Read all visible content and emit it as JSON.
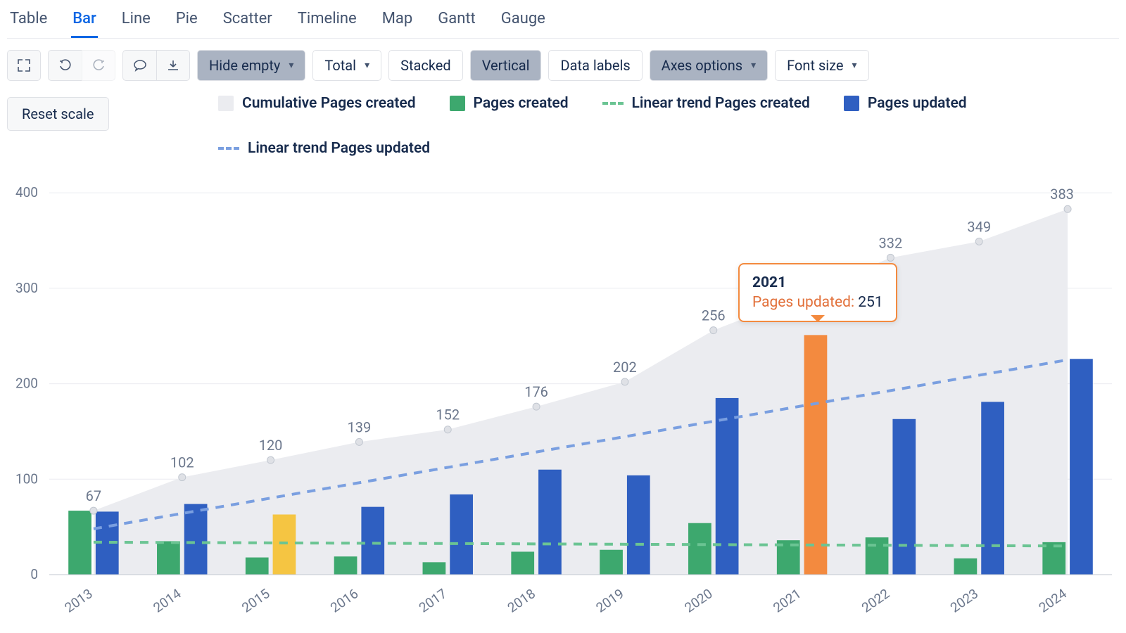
{
  "tabs": [
    "Table",
    "Bar",
    "Line",
    "Pie",
    "Scatter",
    "Timeline",
    "Map",
    "Gantt",
    "Gauge"
  ],
  "active_tab": "Bar",
  "toolbar": {
    "hide_empty": "Hide empty",
    "total": "Total",
    "stacked": "Stacked",
    "vertical": "Vertical",
    "data_labels": "Data labels",
    "axes_options": "Axes options",
    "font_size": "Font size",
    "reset_scale": "Reset scale"
  },
  "legend": {
    "cum": "Cumulative Pages created",
    "created": "Pages created",
    "trend_created": "Linear trend Pages created",
    "updated": "Pages updated",
    "trend_updated": "Linear trend Pages updated"
  },
  "colors": {
    "cum": "#EBECF0",
    "created": "#3DA86E",
    "trend_created": "#6BC493",
    "updated": "#2F5FC1",
    "trend_updated": "#7A9FE0",
    "highlight": "#F38A3F",
    "highlight2": "#F5C542"
  },
  "tooltip": {
    "year": "2021",
    "label": "Pages updated: ",
    "value": "251"
  },
  "chart_data": {
    "type": "bar",
    "categories": [
      "2013",
      "2014",
      "2015",
      "2016",
      "2017",
      "2018",
      "2019",
      "2020",
      "2021",
      "2022",
      "2023",
      "2024"
    ],
    "series": [
      {
        "name": "Pages created",
        "values": [
          67,
          35,
          18,
          19,
          13,
          24,
          26,
          54,
          36,
          39,
          17,
          34
        ]
      },
      {
        "name": "Pages updated",
        "values": [
          66,
          74,
          63,
          71,
          84,
          110,
          104,
          185,
          251,
          163,
          181,
          226
        ]
      },
      {
        "name": "Cumulative Pages created",
        "type": "area",
        "values": [
          67,
          102,
          120,
          139,
          152,
          176,
          202,
          256,
          292,
          332,
          349,
          383
        ]
      }
    ],
    "trends": [
      {
        "name": "Linear trend Pages created",
        "y0": 34,
        "y1": 30
      },
      {
        "name": "Linear trend Pages updated",
        "y0": 48,
        "y1": 225
      }
    ],
    "ylim": [
      0,
      420
    ],
    "yticks": [
      0,
      100,
      200,
      300,
      400
    ],
    "highlight_bar": {
      "year": "2021",
      "series": "Pages updated"
    },
    "secondary_highlight": {
      "year": "2015",
      "series": "Pages updated"
    }
  }
}
